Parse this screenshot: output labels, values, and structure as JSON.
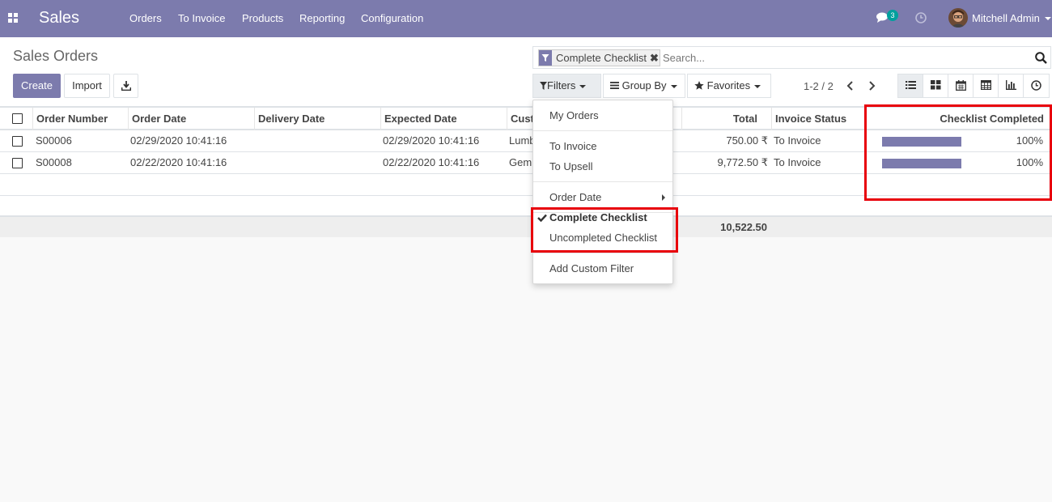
{
  "navbar": {
    "app_name": "Sales",
    "menu": [
      "Orders",
      "To Invoice",
      "Products",
      "Reporting",
      "Configuration"
    ],
    "chat_count": "3",
    "user_name": "Mitchell Admin",
    "icons": [
      "apps-grid-icon",
      "chat-icon",
      "clock-icon",
      "avatar",
      "caret-down-icon"
    ]
  },
  "control_panel": {
    "title": "Sales Orders",
    "create_label": "Create",
    "import_label": "Import",
    "search": {
      "facet_label": "Complete Checklist",
      "placeholder": "Search..."
    },
    "filters_label": "Filters",
    "group_by_label": "Group By",
    "favorites_label": "Favorites",
    "pager": "1-2 / 2",
    "views": [
      "list",
      "kanban",
      "calendar",
      "pivot",
      "graph",
      "activity"
    ]
  },
  "table": {
    "headers": [
      "Order Number",
      "Order Date",
      "Delivery Date",
      "Expected Date",
      "Cust",
      "Total",
      "Invoice Status",
      "Checklist Completed"
    ],
    "rows": [
      {
        "order_number": "S00006",
        "order_date": "02/29/2020 10:41:16",
        "delivery_date": "",
        "expected_date": "02/29/2020 10:41:16",
        "customer": "Lumb",
        "total": "750.00 ₹",
        "invoice_status": "To Invoice",
        "checklist_progress": 100,
        "checklist_label": "100%"
      },
      {
        "order_number": "S00008",
        "order_date": "02/22/2020 10:41:16",
        "delivery_date": "",
        "expected_date": "02/22/2020 10:41:16",
        "customer": "Gemi",
        "total": "9,772.50 ₹",
        "invoice_status": "To Invoice",
        "checklist_progress": 100,
        "checklist_label": "100%"
      }
    ],
    "footer_total": "10,522.50"
  },
  "filters_dropdown": {
    "groups": [
      [
        "My Orders"
      ],
      [
        "To Invoice",
        "To Upsell"
      ],
      [
        "Order Date"
      ],
      [
        "Complete Checklist",
        "Uncompleted Checklist"
      ],
      [
        "Add Custom Filter"
      ]
    ],
    "selected": "Complete Checklist"
  },
  "colors": {
    "brand": "#7c7bad",
    "highlight": "#e8000b",
    "badge": "#00a09d"
  }
}
